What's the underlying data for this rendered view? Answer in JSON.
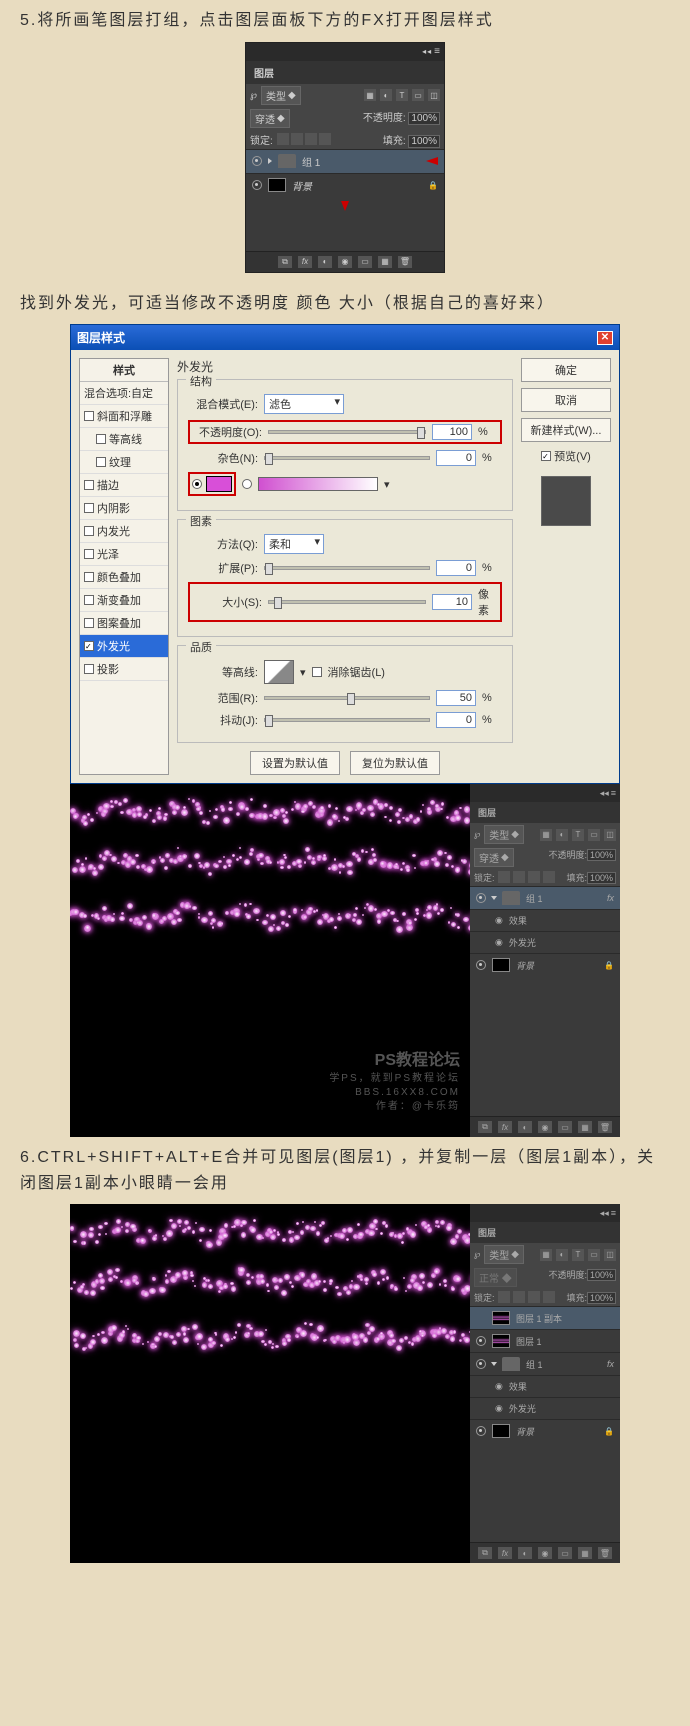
{
  "step5": {
    "text": "5.将所画笔图层打组，点击图层面板下方的FX打开图层样式"
  },
  "step5b": {
    "text": "找到外发光，可适当修改不透明度 颜色 大小（根据自己的喜好来）"
  },
  "step6": {
    "text": "6.CTRL+SHIFT+ALT+E合并可见图层(图层1) ，并复制一层（图层1副本），关闭图层1副本小眼睛一会用"
  },
  "layersPanel": {
    "title": "图层",
    "kindLabel": "类型",
    "blendMode": "穿透",
    "opacityLabel": "不透明度:",
    "opacityValue": "100%",
    "lockLabel": "锁定:",
    "fillLabel": "填充:",
    "fillValue": "100%",
    "group1": "组 1",
    "background": "背景",
    "fxBtn": "fx",
    "effects": "效果",
    "outerGlowFx": "外发光",
    "layer1copy": "图层 1 副本",
    "layer1": "图层 1"
  },
  "dialog": {
    "title": "图层样式",
    "sidebar": {
      "style": "样式",
      "blendOpts": "混合选项:自定",
      "bevel": "斜面和浮雕",
      "contour": "等高线",
      "texture": "纹理",
      "stroke": "描边",
      "innerShadow": "内阴影",
      "innerGlow": "内发光",
      "satin": "光泽",
      "colorOverlay": "颜色叠加",
      "gradientOverlay": "渐变叠加",
      "patternOverlay": "图案叠加",
      "outerGlow": "外发光",
      "dropShadow": "投影"
    },
    "main": {
      "outerGlowTitle": "外发光",
      "structure": "结构",
      "blendMode": "混合模式(E):",
      "blendModeVal": "滤色",
      "opacity": "不透明度(O):",
      "opacityVal": "100",
      "pct": "%",
      "noise": "杂色(N):",
      "noiseVal": "0",
      "elements": "图素",
      "technique": "方法(Q):",
      "techniqueVal": "柔和",
      "spread": "扩展(P):",
      "spreadVal": "0",
      "size": "大小(S):",
      "sizeVal": "10",
      "px": "像素",
      "quality": "品质",
      "antiAlias": "消除锯齿(L)",
      "contour": "等高线:",
      "range": "范围(R):",
      "rangeVal": "50",
      "jitter": "抖动(J):",
      "jitterVal": "0",
      "setDefault": "设置为默认值",
      "resetDefault": "复位为默认值"
    },
    "buttons": {
      "ok": "确定",
      "cancel": "取消",
      "newStyle": "新建样式(W)...",
      "preview": "预览(V)"
    }
  },
  "watermark": {
    "title": "PS教程论坛",
    "sub1": "学PS，就到PS教程论坛",
    "sub2": "BBS.16XX8.COM",
    "author": "作者：@卡乐筠"
  },
  "colors": {
    "glow": "#d84fd8"
  }
}
